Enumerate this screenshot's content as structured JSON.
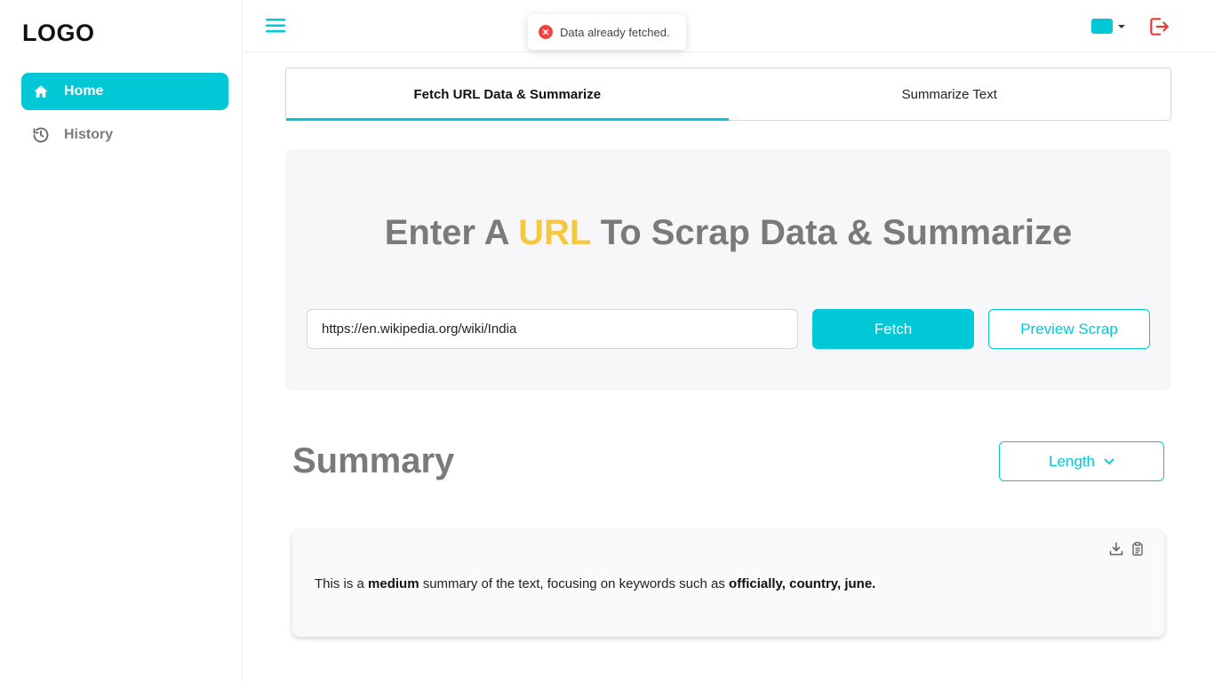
{
  "sidebar": {
    "logo": "LOGO",
    "items": [
      {
        "label": "Home",
        "icon": "home-icon",
        "active": true
      },
      {
        "label": "History",
        "icon": "history-icon",
        "active": false
      }
    ]
  },
  "topbar": {
    "menu_icon": "hamburger-menu-icon",
    "theme_color": "#00c8d7",
    "logout_icon": "logout-icon"
  },
  "toast": {
    "icon": "error-icon",
    "message": "Data already fetched."
  },
  "tabs": [
    {
      "label": "Fetch URL Data & Summarize",
      "active": true
    },
    {
      "label": "Summarize Text",
      "active": false
    }
  ],
  "hero": {
    "title_prefix": "Enter A",
    "title_accent": "URL",
    "title_suffix": "To Scrap Data & Summarize",
    "url_value": "https://en.wikipedia.org/wiki/India",
    "fetch_label": "Fetch",
    "preview_label": "Preview Scrap"
  },
  "summary": {
    "title": "Summary",
    "length_label": "Length",
    "text_part1": "This is a",
    "text_bold1": "medium",
    "text_part2": "summary of the text, focusing on keywords such as",
    "text_bold2": "officially, country, june."
  },
  "colors": {
    "accent": "#00c8d7",
    "highlight": "#f5c842",
    "error": "#ef4444",
    "logout": "#e53935"
  }
}
